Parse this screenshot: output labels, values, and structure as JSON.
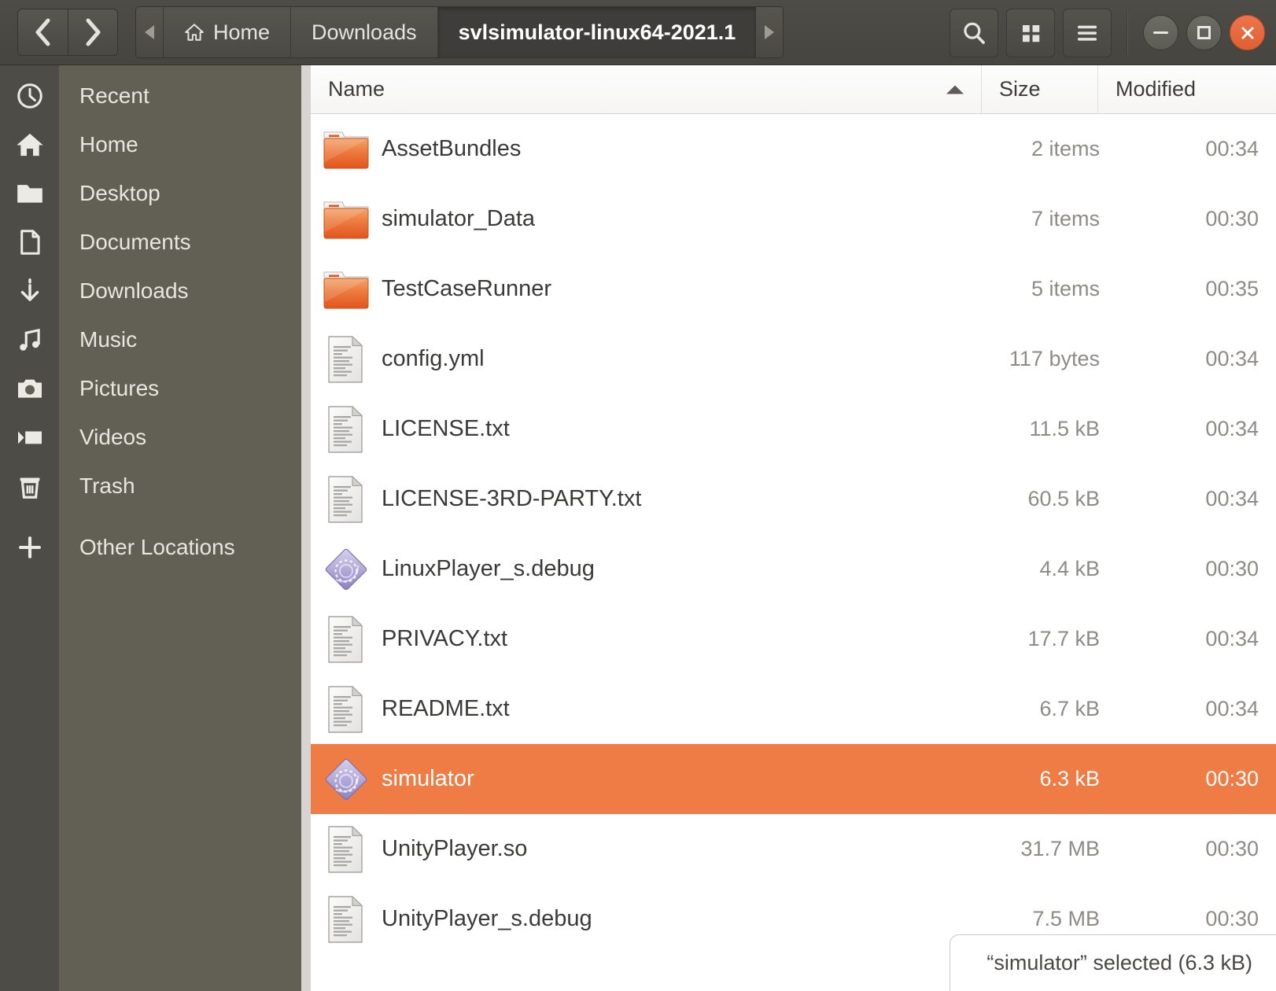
{
  "window": {
    "titlebar_buttons": {
      "minimize": "Minimize",
      "maximize": "Maximize",
      "close": "Close"
    }
  },
  "header": {
    "back_label": "Back",
    "forward_label": "Forward",
    "path_scroll_left": "Scroll path left",
    "path_scroll_right": "Scroll path right",
    "breadcrumbs": [
      {
        "label": "Home",
        "icon": "home-icon",
        "current": false
      },
      {
        "label": "Downloads",
        "icon": "",
        "current": false
      },
      {
        "label": "svlsimulator-linux64-2021.1",
        "icon": "",
        "current": true
      }
    ],
    "tools": {
      "search": "Search",
      "view_grid": "View as grid",
      "menu": "Main menu"
    }
  },
  "sidebar": {
    "items": [
      {
        "label": "Recent",
        "icon": "clock-icon"
      },
      {
        "label": "Home",
        "icon": "home-icon"
      },
      {
        "label": "Desktop",
        "icon": "folder-icon"
      },
      {
        "label": "Documents",
        "icon": "document-icon"
      },
      {
        "label": "Downloads",
        "icon": "download-icon"
      },
      {
        "label": "Music",
        "icon": "music-icon"
      },
      {
        "label": "Pictures",
        "icon": "camera-icon"
      },
      {
        "label": "Videos",
        "icon": "video-icon"
      },
      {
        "label": "Trash",
        "icon": "trash-icon"
      },
      {
        "label": "Other Locations",
        "icon": "plus-icon"
      }
    ]
  },
  "filelist": {
    "columns": {
      "name": "Name",
      "size": "Size",
      "modified": "Modified"
    },
    "sort": {
      "column": "Name",
      "direction": "ascending"
    },
    "rows": [
      {
        "name": "AssetBundles",
        "size": "2 items",
        "modified": "00:34",
        "icon": "folder-icon",
        "selected": false
      },
      {
        "name": "simulator_Data",
        "size": "7 items",
        "modified": "00:30",
        "icon": "folder-icon",
        "selected": false
      },
      {
        "name": "TestCaseRunner",
        "size": "5 items",
        "modified": "00:35",
        "icon": "folder-icon",
        "selected": false
      },
      {
        "name": "config.yml",
        "size": "117 bytes",
        "modified": "00:34",
        "icon": "text-file-icon",
        "selected": false
      },
      {
        "name": "LICENSE.txt",
        "size": "11.5 kB",
        "modified": "00:34",
        "icon": "text-file-icon",
        "selected": false
      },
      {
        "name": "LICENSE-3RD-PARTY.txt",
        "size": "60.5 kB",
        "modified": "00:34",
        "icon": "text-file-icon",
        "selected": false
      },
      {
        "name": "LinuxPlayer_s.debug",
        "size": "4.4 kB",
        "modified": "00:30",
        "icon": "executable-icon",
        "selected": false
      },
      {
        "name": "PRIVACY.txt",
        "size": "17.7 kB",
        "modified": "00:34",
        "icon": "text-file-icon",
        "selected": false
      },
      {
        "name": "README.txt",
        "size": "6.7 kB",
        "modified": "00:34",
        "icon": "text-file-icon",
        "selected": false
      },
      {
        "name": "simulator",
        "size": "6.3 kB",
        "modified": "00:30",
        "icon": "executable-icon",
        "selected": true
      },
      {
        "name": "UnityPlayer.so",
        "size": "31.7 MB",
        "modified": "00:30",
        "icon": "text-file-icon",
        "selected": false
      },
      {
        "name": "UnityPlayer_s.debug",
        "size": "7.5 MB",
        "modified": "00:30",
        "icon": "text-file-icon",
        "selected": false
      }
    ]
  },
  "status": {
    "text": "“simulator” selected  (6.3 kB)"
  },
  "colors": {
    "selection": "#ef7b45",
    "headerbar": "#4a4944",
    "sidebar": "#625f54",
    "sidebar_icons": "#4d4c46",
    "close_button": "#ee7048"
  }
}
